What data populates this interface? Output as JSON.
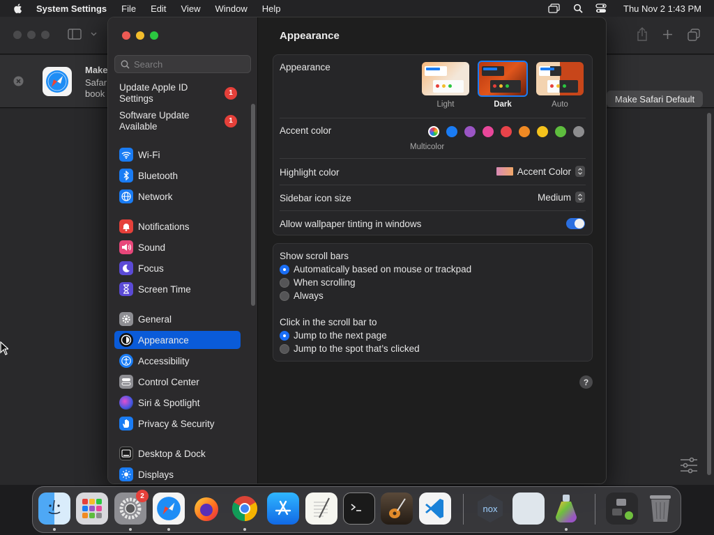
{
  "menubar": {
    "app_name": "System Settings",
    "menus": [
      "File",
      "Edit",
      "View",
      "Window",
      "Help"
    ],
    "clock": "Thu Nov 2  1:43 PM"
  },
  "safari": {
    "banner_title": "Make",
    "banner_line2": "Safar",
    "banner_line3": "book",
    "make_default_label": "Make Safari Default"
  },
  "sidebar": {
    "search_placeholder": "Search",
    "update_items": [
      {
        "label_l1": "Update Apple ID",
        "label_l2": "Settings",
        "badge": "1"
      },
      {
        "label_l1": "Software Update",
        "label_l2": "Available",
        "badge": "1"
      }
    ],
    "items": [
      {
        "label": "Wi-Fi"
      },
      {
        "label": "Bluetooth"
      },
      {
        "label": "Network"
      },
      {
        "label": "Notifications"
      },
      {
        "label": "Sound"
      },
      {
        "label": "Focus"
      },
      {
        "label": "Screen Time"
      },
      {
        "label": "General"
      },
      {
        "label": "Appearance"
      },
      {
        "label": "Accessibility"
      },
      {
        "label": "Control Center"
      },
      {
        "label": "Siri & Spotlight"
      },
      {
        "label": "Privacy & Security"
      },
      {
        "label": "Desktop & Dock"
      },
      {
        "label": "Displays"
      }
    ]
  },
  "main": {
    "title": "Appearance",
    "appearance_label": "Appearance",
    "themes": [
      "Light",
      "Dark",
      "Auto"
    ],
    "selected_theme": "Dark",
    "accent_label": "Accent color",
    "accent_selected_name": "Multicolor",
    "accent_colors": [
      "#1a7cf4",
      "#9a55c4",
      "#e8479a",
      "#e8434a",
      "#f08a24",
      "#f4c21c",
      "#5ebd3e",
      "#8d8d8f"
    ],
    "highlight_label": "Highlight color",
    "highlight_value": "Accent Color",
    "icon_size_label": "Sidebar icon size",
    "icon_size_value": "Medium",
    "tinting_label": "Allow wallpaper tinting in windows",
    "tinting_on": true,
    "scrollbars_label": "Show scroll bars",
    "scrollbar_options": [
      "Automatically based on mouse or trackpad",
      "When scrolling",
      "Always"
    ],
    "click_label": "Click in the scroll bar to",
    "click_options": [
      "Jump to the next page",
      "Jump to the spot that’s clicked"
    ],
    "help": "?"
  },
  "dock": {
    "settings_badge": "2"
  }
}
